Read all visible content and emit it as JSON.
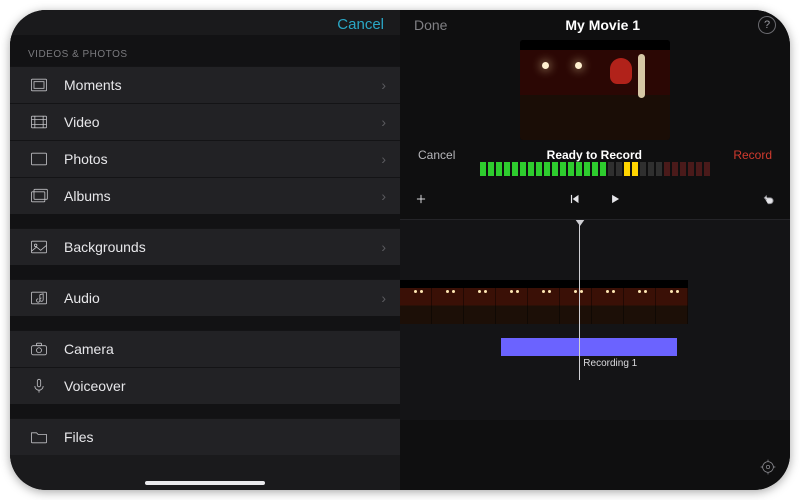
{
  "left": {
    "cancel": "Cancel",
    "section_header": "Videos & Photos",
    "items": [
      {
        "label": "Moments",
        "has_chevron": true
      },
      {
        "label": "Video",
        "has_chevron": true
      },
      {
        "label": "Photos",
        "has_chevron": true
      },
      {
        "label": "Albums",
        "has_chevron": true
      }
    ],
    "group2": [
      {
        "label": "Backgrounds",
        "has_chevron": true
      }
    ],
    "group3": [
      {
        "label": "Audio",
        "has_chevron": true
      }
    ],
    "group4": [
      {
        "label": "Camera",
        "has_chevron": false
      },
      {
        "label": "Voiceover",
        "has_chevron": false
      }
    ],
    "group5": [
      {
        "label": "Files",
        "has_chevron": false
      }
    ]
  },
  "right": {
    "done": "Done",
    "title": "My Movie 1",
    "help_glyph": "?",
    "record": {
      "cancel": "Cancel",
      "status": "Ready to Record",
      "go": "Record"
    },
    "audio_clip_label": "Recording 1"
  }
}
